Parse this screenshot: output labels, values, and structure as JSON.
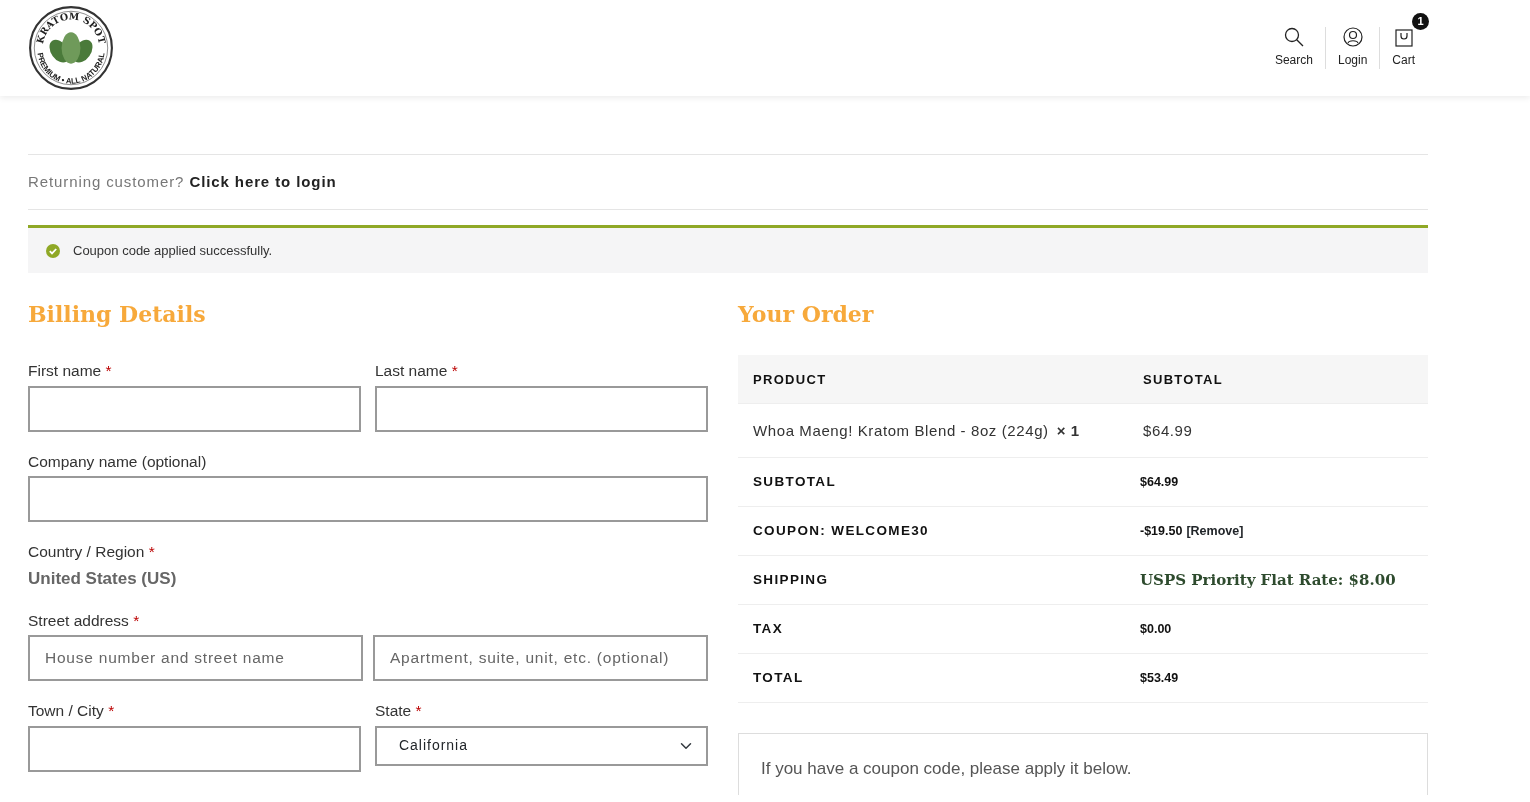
{
  "header": {
    "logo": {
      "top_text": "KRATOM SPOT",
      "bottom_text": "PREMIUM • ALL NATURAL"
    },
    "actions": [
      {
        "kind": "search",
        "label": "Search"
      },
      {
        "kind": "login",
        "label": "Login"
      },
      {
        "kind": "cart",
        "label": "Cart",
        "count": "1"
      }
    ]
  },
  "login_notice": {
    "text": "Returning customer?",
    "link": "Click here to login"
  },
  "success_message": "Coupon code applied successfully.",
  "billing": {
    "title": "Billing Details",
    "rows": [
      [
        {
          "kind": "input",
          "label": "First name",
          "required_mark": "*"
        },
        {
          "kind": "input",
          "label": "Last name",
          "required_mark": "*"
        }
      ],
      [
        {
          "kind": "input",
          "label": "Company name (optional)"
        }
      ],
      [
        {
          "kind": "static",
          "label": "Country / Region",
          "required_mark": "*",
          "value": "United States (US)"
        }
      ],
      [
        {
          "kind": "pair",
          "label": "Street address",
          "required_mark": "*",
          "placeholders": [
            "House number and street name",
            "Apartment, suite, unit, etc. (optional)"
          ]
        }
      ],
      [
        {
          "kind": "input",
          "label": "Town / City",
          "required_mark": "*"
        },
        {
          "kind": "select",
          "label": "State",
          "required_mark": "*",
          "value": "California"
        }
      ]
    ]
  },
  "order": {
    "title": "Your Order",
    "columns": [
      "PRODUCT",
      "SUBTOTAL"
    ],
    "items": [
      {
        "name": "Whoa Maeng! Kratom Blend - 8oz (224g)",
        "quantity": "× 1",
        "subtotal": "$64.99"
      }
    ],
    "totals": [
      {
        "kind": "plain",
        "label": "SUBTOTAL",
        "value": "$64.99"
      },
      {
        "kind": "coupon",
        "label": "COUPON: WELCOME30",
        "value": "-$19.50",
        "link": "[Remove]"
      },
      {
        "kind": "shipping",
        "label": "SHIPPING",
        "value": "USPS Priority Flat Rate: **$8.00**"
      },
      {
        "kind": "plain",
        "label": "TAX",
        "value": "$0.00"
      },
      {
        "kind": "plain",
        "label": "TOTAL",
        "value": "$53.49"
      }
    ],
    "coupon_prompt": "If you have a coupon code, please apply it below."
  }
}
